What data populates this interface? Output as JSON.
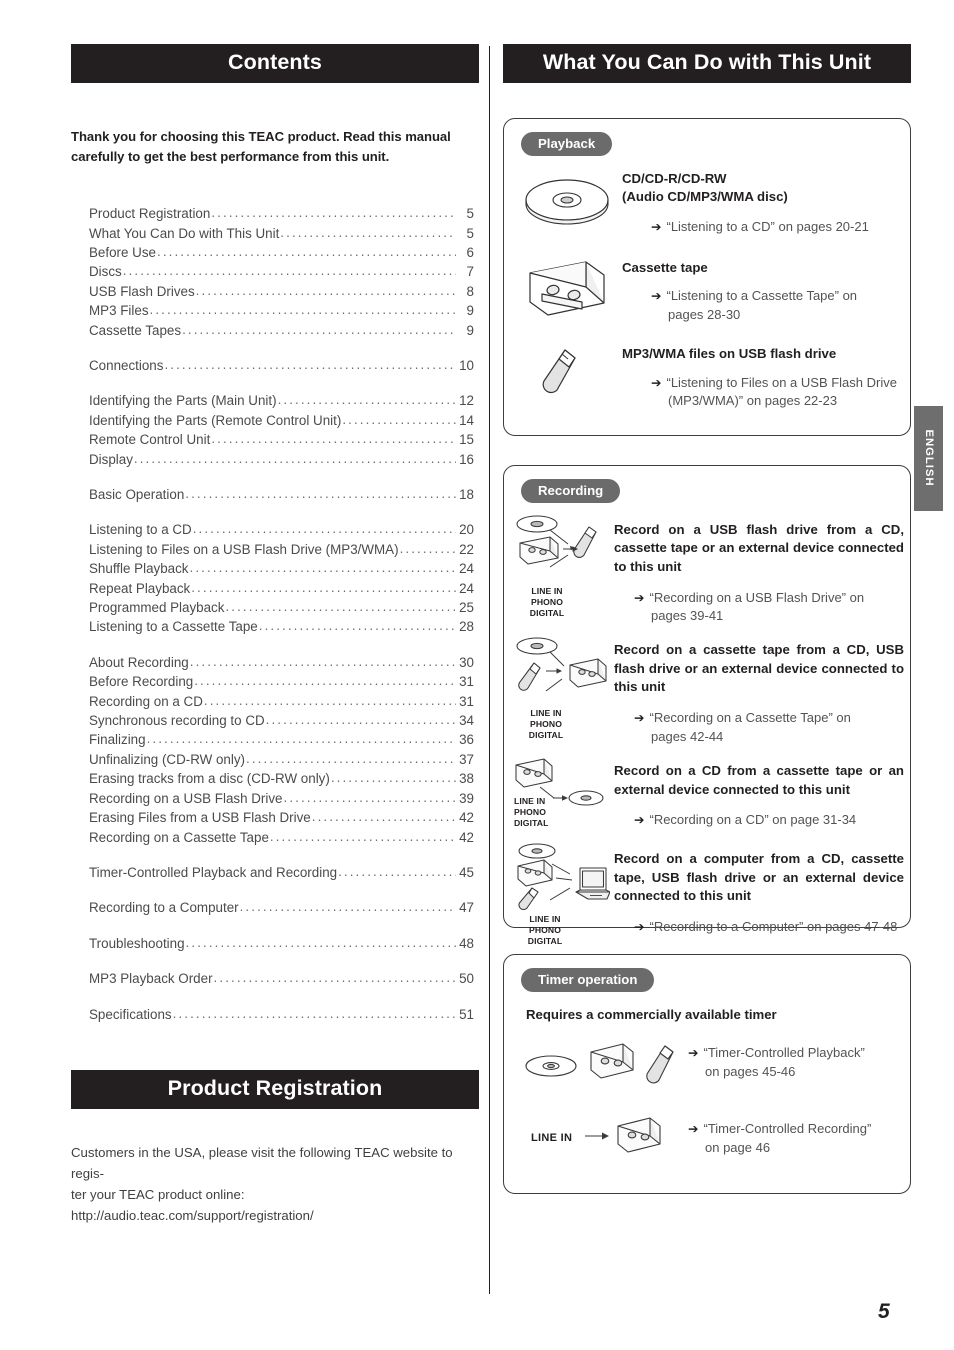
{
  "page": {
    "number": "5",
    "side_tab": "ENGLISH"
  },
  "left": {
    "contents_heading": "Contents",
    "intro": "Thank you for choosing this TEAC product. Read this manual carefully to get the best performance from this unit.",
    "toc": [
      {
        "label": "Product Registration",
        "page": "5"
      },
      {
        "label": "What You Can Do with This Unit",
        "page": "5"
      },
      {
        "label": "Before Use",
        "page": "6"
      },
      {
        "label": "Discs",
        "page": "7"
      },
      {
        "label": "USB Flash Drives",
        "page": "8"
      },
      {
        "label": "MP3 Files",
        "page": "9"
      },
      {
        "label": "Cassette Tapes",
        "page": "9"
      },
      {
        "label": "Connections",
        "page": "10"
      },
      {
        "label": "Identifying the Parts (Main Unit)",
        "page": "12"
      },
      {
        "label": "Identifying the Parts (Remote Control Unit)",
        "page": "14"
      },
      {
        "label": "Remote Control Unit",
        "page": "15"
      },
      {
        "label": "Display",
        "page": "16"
      },
      {
        "label": "Basic Operation",
        "page": "18"
      },
      {
        "label": "Listening to a CD",
        "page": "20"
      },
      {
        "label": "Listening to Files on a USB Flash Drive (MP3/WMA)",
        "page": "22"
      },
      {
        "label": "Shuffle Playback",
        "page": "24"
      },
      {
        "label": "Repeat Playback",
        "page": "24"
      },
      {
        "label": "Programmed Playback",
        "page": "25"
      },
      {
        "label": "Listening to a Cassette Tape",
        "page": "28"
      },
      {
        "label": "About Recording",
        "page": "30"
      },
      {
        "label": "Before Recording",
        "page": "31"
      },
      {
        "label": "Recording on a CD",
        "page": "31"
      },
      {
        "label": "Synchronous recording to CD",
        "page": "34"
      },
      {
        "label": "Finalizing",
        "page": "36"
      },
      {
        "label": "Unfinalizing (CD-RW only)",
        "page": "37"
      },
      {
        "label": "Erasing tracks from a disc (CD-RW only)",
        "page": "38"
      },
      {
        "label": "Recording on a USB Flash Drive",
        "page": "39"
      },
      {
        "label": "Erasing Files from a USB Flash Drive",
        "page": "42"
      },
      {
        "label": "Recording on a Cassette Tape",
        "page": "42"
      },
      {
        "label": "Timer-Controlled Playback and Recording",
        "page": "45"
      },
      {
        "label": "Recording to a Computer",
        "page": "47"
      },
      {
        "label": "Troubleshooting",
        "page": "48"
      },
      {
        "label": "MP3 Playback Order",
        "page": "50"
      },
      {
        "label": "Specifications",
        "page": "51"
      }
    ],
    "registration_heading": "Product Registration",
    "registration_body_line1": "Customers in the USA, please visit the following TEAC website to regis-",
    "registration_body_line2": "ter your TEAC product online:",
    "registration_url": "http://audio.teac.com/support/registration/"
  },
  "right": {
    "heading": "What You Can Do with This Unit",
    "playback": {
      "badge": "Playback",
      "items": [
        {
          "icon": "cd-disc-icon",
          "title_line1": "CD/CD-R/CD-RW",
          "title_line2": "(Audio CD/MP3/WMA disc)",
          "ref_line1": "“Listening to a CD” on pages 20-21",
          "ref_line2": ""
        },
        {
          "icon": "cassette-tape-icon",
          "title_line1": "Cassette tape",
          "title_line2": "",
          "ref_line1": "“Listening to a Cassette Tape” on",
          "ref_line2": "pages 28-30"
        },
        {
          "icon": "usb-flash-drive-icon",
          "title_line1": "MP3/WMA files on USB flash drive",
          "title_line2": "",
          "ref_line1": "“Listening to Files on a USB Flash Drive",
          "ref_line2": "(MP3/WMA)” on pages 22-23"
        }
      ]
    },
    "recording": {
      "badge": "Recording",
      "source_caption": [
        "LINE IN",
        "PHONO",
        "DIGITAL"
      ],
      "items": [
        {
          "diagram": "cd-cassette-linein-to-usb",
          "title": "Record on a USB flash drive from a CD, cassette tape or an external device connected to this unit",
          "ref_line1": "“Recording on a USB Flash Drive” on",
          "ref_line2": "pages 39-41"
        },
        {
          "diagram": "cd-usb-linein-to-cassette",
          "title": "Record on a cassette tape from a CD, USB flash drive or an external device connected to this unit",
          "ref_line1": "“Recording on a Cassette Tape” on",
          "ref_line2": "pages 42-44"
        },
        {
          "diagram": "cassette-linein-to-cd",
          "title": "Record on a CD from a cassette tape or an external device connected to this unit",
          "ref_line1": "“Recording on a CD” on page 31-34",
          "ref_line2": ""
        },
        {
          "diagram": "cd-cassette-usb-linein-to-computer",
          "title": "Record on a computer from a CD, cassette tape, USB flash drive or an external device connected to this unit",
          "ref_line1": "“Recording to a Computer” on pages 47-48",
          "ref_line2": ""
        }
      ]
    },
    "timer": {
      "badge": "Timer operation",
      "note": "Requires a commercially available timer",
      "items": [
        {
          "diagram": "cd-cassette-usb-icons",
          "ref_line1": "“Timer-Controlled Playback”",
          "ref_line2": "on pages 45-46"
        },
        {
          "diagram": "linein-to-cassette",
          "linein_label": "LINE IN",
          "ref_line1": "“Timer-Controlled Recording”",
          "ref_line2": "on page 46"
        }
      ]
    }
  },
  "colors": {
    "bar_dark": "#231f20",
    "badge_gray": "#6b6b6b",
    "tab_gray": "#6e6e6e",
    "body_text": "#4b4b4b"
  }
}
